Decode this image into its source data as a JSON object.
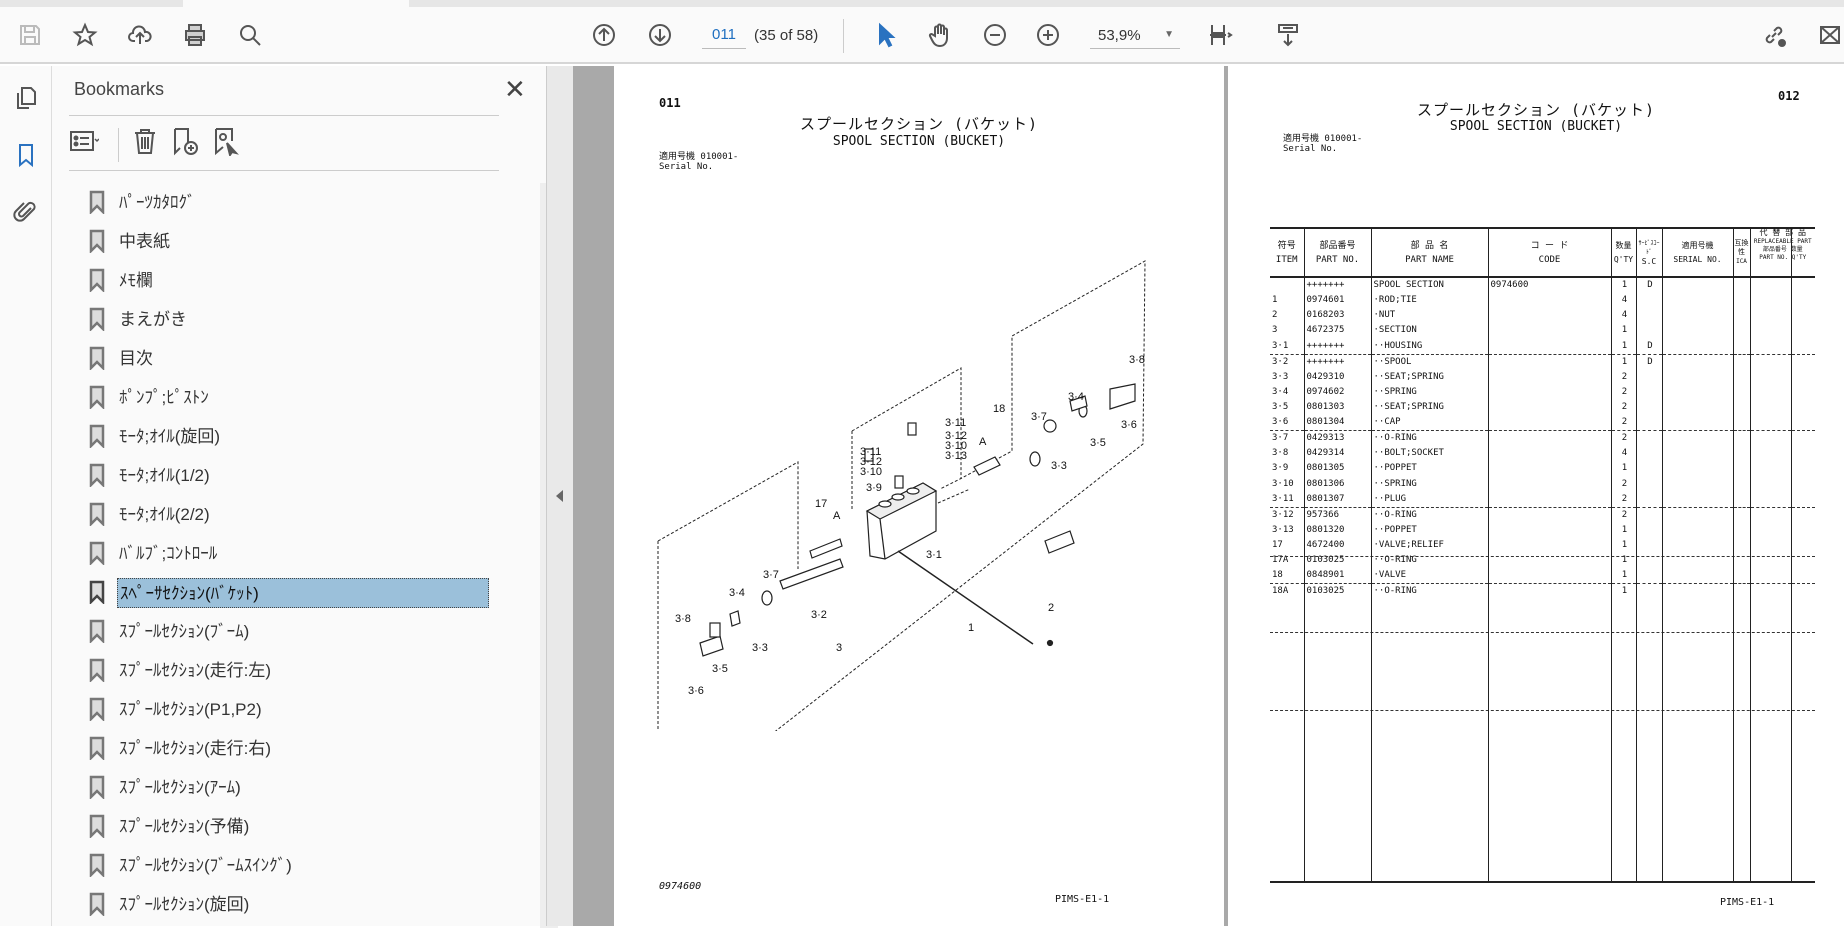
{
  "toolbar": {
    "page_input": "011",
    "page_count": "(35 of 58)",
    "zoom": "53,9%"
  },
  "bookmarks": {
    "title": "Bookmarks",
    "close": "✕",
    "items": [
      {
        "label": "ﾊﾟｰﾂｶﾀﾛｸﾞ"
      },
      {
        "label": "中表紙"
      },
      {
        "label": "ﾒﾓ欄"
      },
      {
        "label": "まえがき"
      },
      {
        "label": "目次"
      },
      {
        "label": "ﾎﾟﾝﾌﾟ;ﾋﾟｽﾄﾝ"
      },
      {
        "label": "ﾓｰﾀ;ｵｲﾙ(旋回)"
      },
      {
        "label": "ﾓｰﾀ;ｵｲﾙ(1/2)"
      },
      {
        "label": "ﾓｰﾀ;ｵｲﾙ(2/2)"
      },
      {
        "label": "ﾊﾞﾙﾌﾞ;ｺﾝﾄﾛｰﾙ"
      },
      {
        "label": "ｽﾍﾟｰｻｾｸｼｮﾝ(ﾊﾞｹｯﾄ)",
        "selected": true
      },
      {
        "label": "ｽﾌﾟｰﾙｾｸｼｮﾝ(ﾌﾞｰﾑ)"
      },
      {
        "label": "ｽﾌﾟｰﾙｾｸｼｮﾝ(走行:左)"
      },
      {
        "label": "ｽﾌﾟｰﾙｾｸｼｮﾝ(P1,P2)"
      },
      {
        "label": "ｽﾌﾟｰﾙｾｸｼｮﾝ(走行:右)"
      },
      {
        "label": "ｽﾌﾟｰﾙｾｸｼｮﾝ(ｱｰﾑ)"
      },
      {
        "label": "ｽﾌﾟｰﾙｾｸｼｮﾝ(予備)"
      },
      {
        "label": "ｽﾌﾟｰﾙｾｸｼｮﾝ(ﾌﾞｰﾑｽｲﾝｸﾞ)"
      },
      {
        "label": "ｽﾌﾟｰﾙｾｸｼｮﾝ(旋回)"
      }
    ]
  },
  "left_page": {
    "page_no": "011",
    "title_jp": "スプールセクション (バケット)",
    "title_en": "SPOOL SECTION (BUCKET)",
    "serial_jp": "適用号機  010001-",
    "serial_en": "Serial No.",
    "footer_part": "0974600",
    "footer_code": "PIMS-E1-1",
    "callouts": [
      "3·8",
      "3·4",
      "3·6",
      "3·5",
      "3·3",
      "3·7",
      "18",
      "A",
      "3·11",
      "3·12",
      "3·10",
      "3·13",
      "3·11",
      "3·12",
      "3·10",
      "3·9",
      "17",
      "A",
      "3·1",
      "3·7",
      "3·4",
      "3·8",
      "3·3",
      "3·2",
      "3·5",
      "3·6",
      "3",
      "1",
      "2"
    ]
  },
  "right_page": {
    "page_no": "012",
    "title_jp": "スプールセクション (バケット)",
    "title_en": "SPOOL SECTION (BUCKET)",
    "serial_jp": "適用号機  010001-",
    "serial_en": "Serial No.",
    "footer_code": "PIMS-E1-1",
    "headers": {
      "item_jp": "符号",
      "item_en": "ITEM",
      "partno_jp": "部品番号",
      "partno_en": "PART NO.",
      "name_jp": "部 品 名",
      "name_en": "PART NAME",
      "code_jp": "コ ー ド",
      "code_en": "CODE",
      "qty_jp": "数量",
      "qty_en": "Q'TY",
      "sc_jp": "ｻｰﾋﾞｽｺｰﾄﾞ",
      "sc_en": "S.C",
      "serial_jp": "適用号機",
      "serial_en": "SERIAL NO.",
      "ica_jp": "互換性",
      "ica_en": "ICA",
      "repl_jp": "代 替 部 品",
      "repl_en": "REPLACEABLE PART",
      "repl_partno_jp": "部品番号",
      "repl_partno_en": "PART NO.",
      "repl_qty_jp": "数量",
      "repl_qty_en": "Q'TY"
    },
    "rows": [
      {
        "item": "",
        "part_no": "+++++++",
        "name": "SPOOL SECTION",
        "code": "0974600",
        "qty": "1",
        "sc": "D"
      },
      {
        "item": "1",
        "part_no": "0974601",
        "name": "·ROD;TIE",
        "code": "",
        "qty": "4",
        "sc": ""
      },
      {
        "item": "2",
        "part_no": "0168203",
        "name": "·NUT",
        "code": "",
        "qty": "4",
        "sc": ""
      },
      {
        "item": "3",
        "part_no": "4672375",
        "name": "·SECTION",
        "code": "",
        "qty": "1",
        "sc": ""
      },
      {
        "item": "3·1",
        "part_no": "+++++++",
        "name": "··HOUSING",
        "code": "",
        "qty": "1",
        "sc": "D"
      },
      {
        "item": "3·2",
        "part_no": "+++++++",
        "name": "··SPOOL",
        "code": "",
        "qty": "1",
        "sc": "D"
      },
      {
        "item": "3·3",
        "part_no": "0429310",
        "name": "··SEAT;SPRING",
        "code": "",
        "qty": "2",
        "sc": ""
      },
      {
        "item": "3·4",
        "part_no": "0974602",
        "name": "··SPRING",
        "code": "",
        "qty": "2",
        "sc": ""
      },
      {
        "item": "3·5",
        "part_no": "0801303",
        "name": "··SEAT;SPRING",
        "code": "",
        "qty": "2",
        "sc": ""
      },
      {
        "item": "3·6",
        "part_no": "0801304",
        "name": "··CAP",
        "code": "",
        "qty": "2",
        "sc": ""
      },
      {
        "item": "3·7",
        "part_no": "0429313",
        "name": "··O-RING",
        "code": "",
        "qty": "2",
        "sc": ""
      },
      {
        "item": "3·8",
        "part_no": "0429314",
        "name": "··BOLT;SOCKET",
        "code": "",
        "qty": "4",
        "sc": ""
      },
      {
        "item": "3·9",
        "part_no": "0801305",
        "name": "··POPPET",
        "code": "",
        "qty": "1",
        "sc": ""
      },
      {
        "item": "3·10",
        "part_no": "0801306",
        "name": "··SPRING",
        "code": "",
        "qty": "2",
        "sc": ""
      },
      {
        "item": "3·11",
        "part_no": "0801307",
        "name": "··PLUG",
        "code": "",
        "qty": "2",
        "sc": ""
      },
      {
        "item": "3·12",
        "part_no": "957366",
        "name": "··O-RING",
        "code": "",
        "qty": "2",
        "sc": ""
      },
      {
        "item": "3·13",
        "part_no": "0801320",
        "name": "··POPPET",
        "code": "",
        "qty": "1",
        "sc": ""
      },
      {
        "item": "17",
        "part_no": "4672400",
        "name": "·VALVE;RELIEF",
        "code": "",
        "qty": "1",
        "sc": ""
      },
      {
        "item": "17A",
        "part_no": "0103025",
        "name": "··O-RING",
        "code": "",
        "qty": "1",
        "sc": ""
      },
      {
        "item": "18",
        "part_no": "0848901",
        "name": "·VALVE",
        "code": "",
        "qty": "1",
        "sc": ""
      },
      {
        "item": "18A",
        "part_no": "0103025",
        "name": "··O-RING",
        "code": "",
        "qty": "1",
        "sc": ""
      }
    ]
  }
}
